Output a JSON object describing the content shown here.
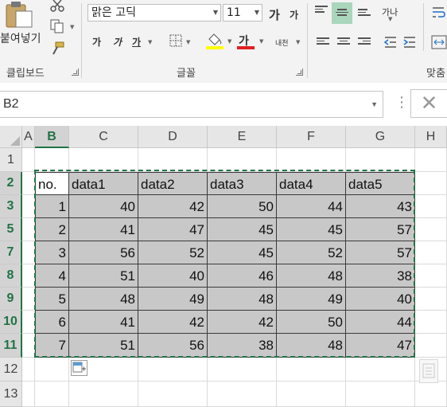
{
  "ribbon": {
    "clipboard": {
      "paste_label": "붙여넣기",
      "group_label": "클립보드"
    },
    "font": {
      "font_name": "맑은 고딕",
      "font_size": "11",
      "grow_label": "가",
      "shrink_label": "가",
      "bold_label": "가",
      "italic_label": "가",
      "underline_label": "가",
      "font_color_label": "가",
      "phonetic_label": "내천",
      "group_label": "글꼴",
      "highlight_color": "#ffff00",
      "font_color": "#e02020"
    },
    "alignment": {
      "wrap_label": "가나",
      "group_label": "맞춤"
    }
  },
  "formula_bar": {
    "name_box": "B2",
    "cancel_icon": "✕"
  },
  "sheet": {
    "columns": [
      "A",
      "B",
      "C",
      "D",
      "E",
      "F",
      "G",
      "H"
    ],
    "rows": [
      "1",
      "2",
      "3",
      "5",
      "7",
      "8",
      "9",
      "10",
      "11",
      "12",
      "13"
    ],
    "headers": [
      "no.",
      "data1",
      "data2",
      "data3",
      "data4",
      "data5"
    ],
    "data": [
      [
        "1",
        "40",
        "42",
        "50",
        "44",
        "43"
      ],
      [
        "2",
        "41",
        "47",
        "45",
        "45",
        "57"
      ],
      [
        "3",
        "56",
        "52",
        "45",
        "52",
        "57"
      ],
      [
        "4",
        "51",
        "40",
        "46",
        "48",
        "38"
      ],
      [
        "5",
        "48",
        "49",
        "48",
        "49",
        "40"
      ],
      [
        "6",
        "41",
        "42",
        "42",
        "50",
        "44"
      ],
      [
        "7",
        "51",
        "56",
        "38",
        "48",
        "47"
      ]
    ],
    "selected_cell": "B2",
    "accent_color": "#217346",
    "selection_fill": "#c8c8c8"
  }
}
